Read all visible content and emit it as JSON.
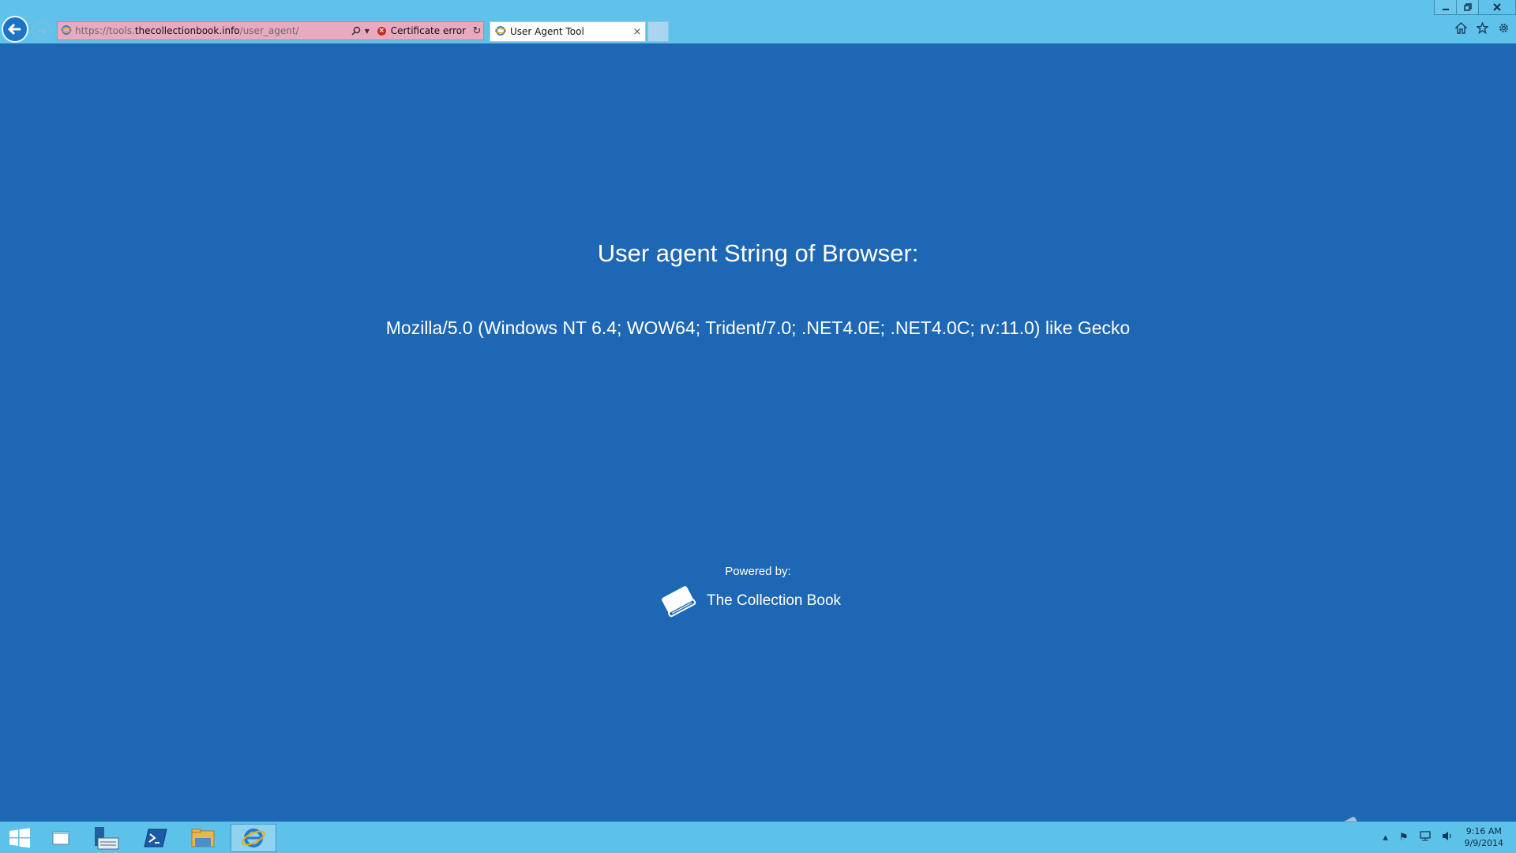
{
  "browser": {
    "address": {
      "url_prefix": "https://tools.",
      "url_domain": "thecollectionbook.info",
      "url_path": "/user_agent/",
      "cert_error_label": "Certificate error"
    },
    "tab": {
      "title": "User Agent Tool",
      "close_glyph": "×"
    },
    "icons": {
      "back": "back-arrow-icon",
      "forward": "forward-arrow-icon",
      "home": "home-icon",
      "favorites": "star-icon",
      "tools": "gear-icon"
    }
  },
  "page": {
    "heading": "User agent String of Browser:",
    "user_agent": "Mozilla/5.0 (Windows NT 6.4; WOW64; Trident/7.0; .NET4.0E; .NET4.0C; rv:11.0) like Gecko",
    "powered_by_label": "Powered by:",
    "brand_name": "The Collection Book"
  },
  "taskbar": {
    "clock_time": "9:16 AM",
    "clock_date": "9/9/2014",
    "items": [
      "start",
      "explorer-window",
      "server-manager",
      "powershell",
      "file-explorer",
      "internet-explorer"
    ]
  },
  "watermark": {
    "text": "The Collection Book"
  },
  "colors": {
    "page_background": "#1e67b5",
    "chrome_background": "#5fc2ea",
    "address_error_background": "#e9a9bf",
    "taskbar_background": "#5cc2ea"
  }
}
